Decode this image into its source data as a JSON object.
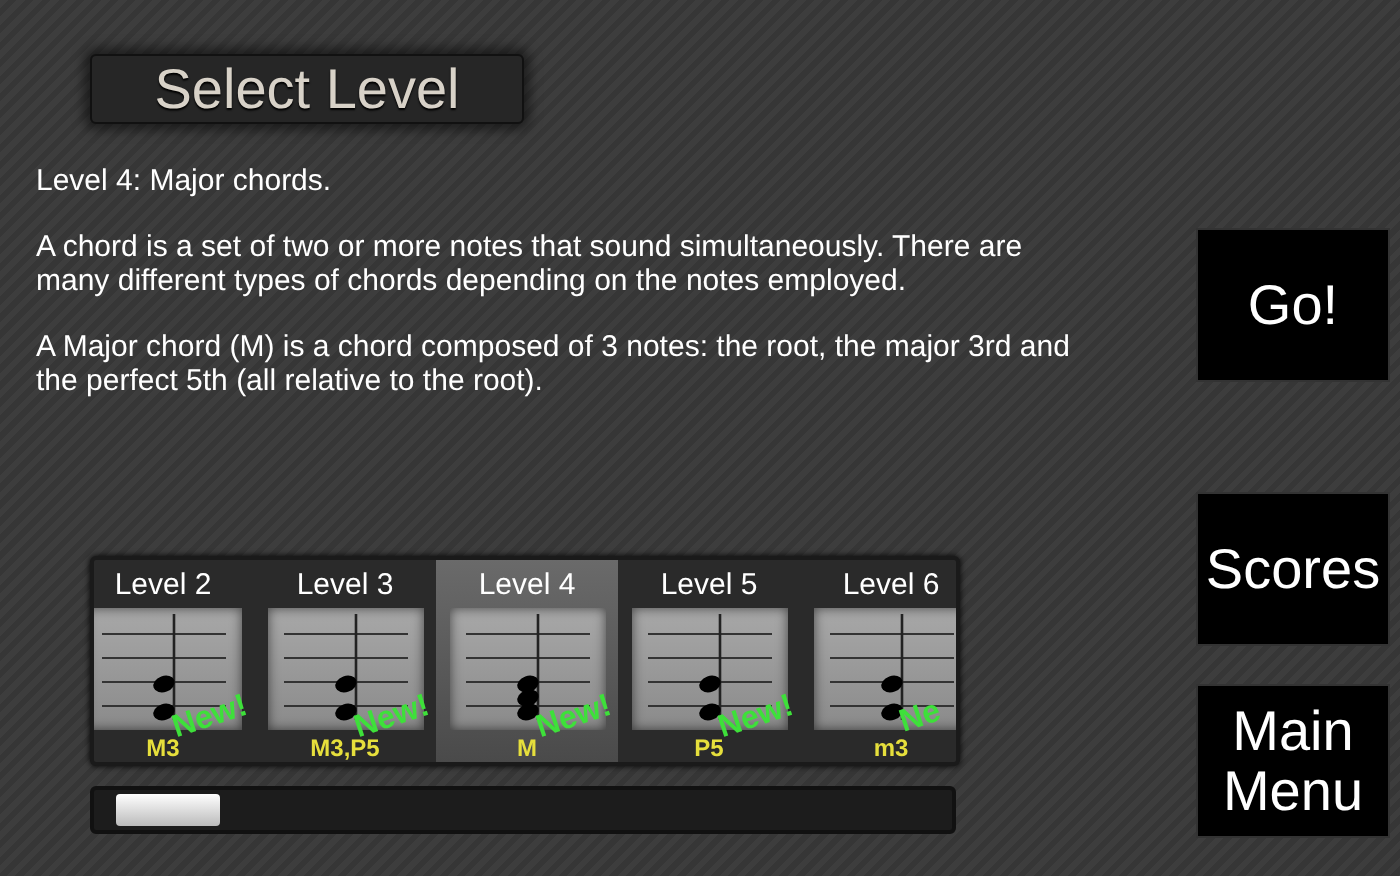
{
  "title": "Select Level",
  "description": [
    "Level 4: Major chords.",
    "A chord is a set of two or more notes that sound simultaneously. There are many different types of chords depending on the notes employed.",
    "A Major chord (M) is a chord composed of 3 notes: the root, the major 3rd and the perfect 5th (all relative to the root)."
  ],
  "levels": [
    {
      "label": "Level 2",
      "kind": "dyad",
      "badge": "New!",
      "interval": "M3",
      "selected": false
    },
    {
      "label": "Level 3",
      "kind": "dyad",
      "badge": "New!",
      "interval": "M3,P5",
      "selected": false
    },
    {
      "label": "Level 4",
      "kind": "triad",
      "badge": "New!",
      "interval": "M",
      "selected": true
    },
    {
      "label": "Level 5",
      "kind": "dyad",
      "badge": "New!",
      "interval": "P5",
      "selected": false
    },
    {
      "label": "Level 6",
      "kind": "dyad",
      "badge": "Ne",
      "interval": "m3",
      "selected": false
    }
  ],
  "buttons": [
    "Go!",
    "Scores",
    "Main Menu"
  ]
}
